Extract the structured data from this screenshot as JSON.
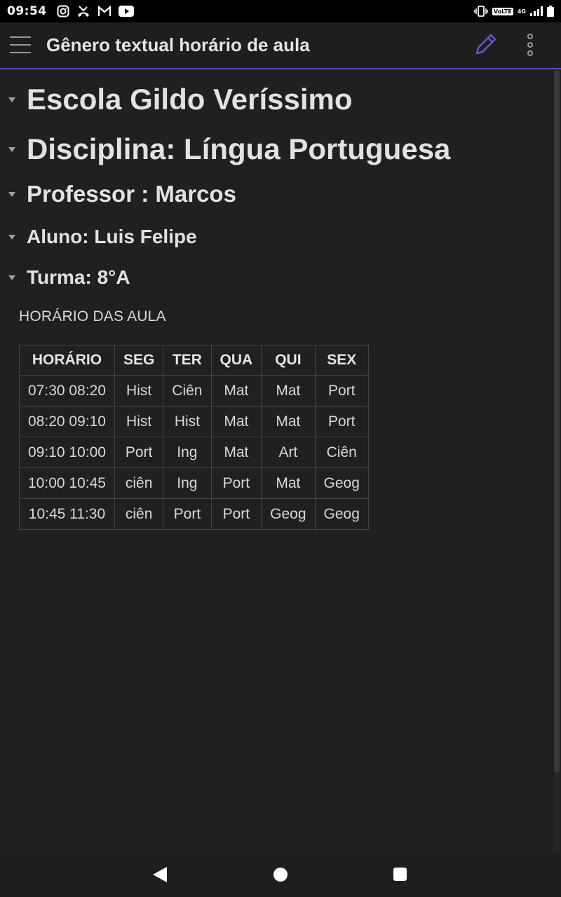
{
  "status_bar": {
    "time": "09:54",
    "notification_icons": [
      "instagram-icon",
      "missed-call-icon",
      "gmail-icon",
      "youtube-icon"
    ],
    "volte": "VoLTE",
    "network": "4G"
  },
  "app_bar": {
    "title": "Gênero textual horário de aula",
    "accent_color": "#6b55d6"
  },
  "document": {
    "headings": [
      {
        "text": "Escola Gildo Veríssimo",
        "level": 1
      },
      {
        "text": "Disciplina: Língua Portuguesa",
        "level": 1
      },
      {
        "text": "Professor : Marcos",
        "level": 2
      },
      {
        "text": "Aluno: Luis Felipe",
        "level": 3
      },
      {
        "text": "Turma: 8°A",
        "level": 3
      }
    ],
    "paragraph": "HORÁRIO DAS AULA",
    "table": {
      "headers": [
        "HORÁRIO",
        "SEG",
        "TER",
        "QUA",
        "QUI",
        "SEX"
      ],
      "rows": [
        [
          "07:30 08:20",
          "Hist",
          "Ciên",
          "Mat",
          "Mat",
          "Port"
        ],
        [
          "08:20 09:10",
          "Hist",
          "Hist",
          "Mat",
          "Mat",
          "Port"
        ],
        [
          "09:10 10:00",
          "Port",
          "Ing",
          "Mat",
          "Art",
          "Ciên"
        ],
        [
          "10:00 10:45",
          "ciên",
          "Ing",
          "Port",
          "Mat",
          "Geog"
        ],
        [
          "10:45 11:30",
          "ciên",
          "Port",
          "Port",
          "Geog",
          "Geog"
        ]
      ]
    }
  }
}
